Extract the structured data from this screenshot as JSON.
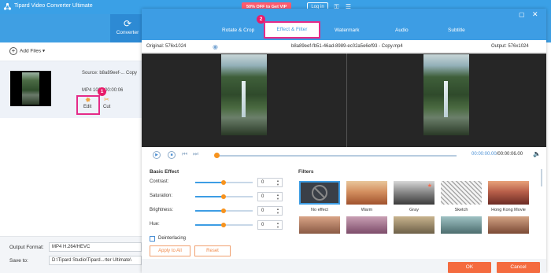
{
  "app": {
    "title": "Tipard Video Converter Ultimate",
    "promo": "50% OFF to Get VIP",
    "login": "Log in",
    "converter_tab": "Converter",
    "add_files": "Add Files",
    "source": "Source: b8a89eef-... Copy",
    "meta": "MP4    1024    00:00:06",
    "edit": "Edit",
    "cut": "Cut",
    "output_format_label": "Output Format:",
    "output_format_value": "MP4 H.264/HEVC",
    "save_to_label": "Save to:",
    "save_to_value": "D:\\Tipard Studio\\Tipard...rter Ultimate\\"
  },
  "badges": {
    "step1": "1",
    "step2": "2"
  },
  "dialog": {
    "tabs": [
      "Rotate & Crop",
      "Effect & Filter",
      "Watermark",
      "Audio",
      "Subtitle"
    ],
    "original": "Original: 576x1024",
    "filename": "b8a89eef-fb51-46ad-8989-ec02a5e6ef93 - Copy.mp4",
    "output": "Output: 576x1024",
    "time_current": "00:00:00.00",
    "time_total": "/00:00:06.00"
  },
  "basic_effect": {
    "title": "Basic Effect",
    "rows": [
      {
        "label": "Contrast:",
        "value": "0",
        "level": 0.5
      },
      {
        "label": "Saturation:",
        "value": "0",
        "level": 0.5
      },
      {
        "label": "Brightness:",
        "value": "0",
        "level": 0.5
      },
      {
        "label": "Hue:",
        "value": "0",
        "level": 0.5
      }
    ],
    "deinterlacing": "Deinterlacing",
    "apply_all": "Apply to All",
    "reset": "Reset"
  },
  "filters": {
    "title": "Filters",
    "items": [
      "No effect",
      "Warm",
      "Gray",
      "Sketch",
      "Hong Kong Movie"
    ]
  },
  "footer": {
    "ok": "OK",
    "cancel": "Cancel"
  }
}
